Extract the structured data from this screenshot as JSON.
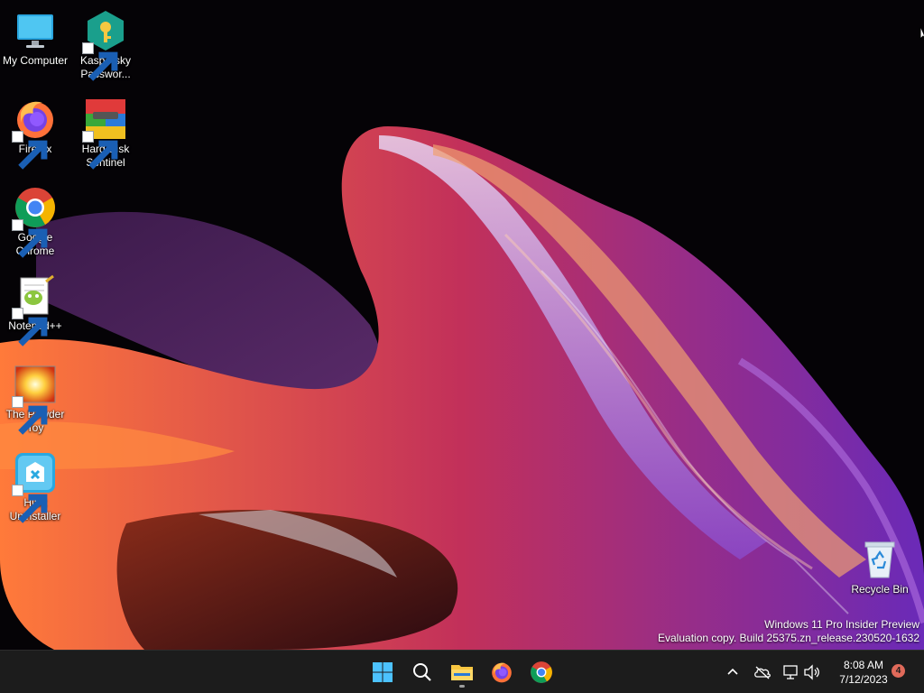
{
  "desktop": {
    "icons": [
      {
        "label": "My Computer",
        "icon": "monitor-icon"
      },
      {
        "label": "Kaspersky Passwor...",
        "icon": "kaspersky-password-icon"
      },
      {
        "label": "Firefox",
        "icon": "firefox-icon"
      },
      {
        "label": "Hard Disk Sentinel",
        "icon": "hard-disk-sentinel-icon"
      },
      {
        "label": "Google Chrome",
        "icon": "chrome-icon"
      },
      {
        "label": "Notepad++",
        "icon": "notepad-plus-plus-icon"
      },
      {
        "label": "The Powder Toy",
        "icon": "powder-toy-icon"
      },
      {
        "label": "HiBit Uninstaller",
        "icon": "hibit-uninstaller-icon"
      },
      {
        "label": "Recycle Bin",
        "icon": "recycle-bin-icon"
      }
    ],
    "watermark": {
      "line1": "Windows 11 Pro Insider Preview",
      "line2": "Evaluation copy. Build 25375.zn_release.230520-1632"
    }
  },
  "taskbar": {
    "pinned": [
      {
        "icon": "windows-start-icon"
      },
      {
        "icon": "search-icon"
      },
      {
        "icon": "file-explorer-icon",
        "running": true
      },
      {
        "icon": "firefox-icon"
      },
      {
        "icon": "chrome-icon"
      }
    ],
    "tray": {
      "icons": [
        "chevron-up-icon",
        "onedrive-offline-icon",
        "network-icon",
        "volume-icon"
      ],
      "time": "8:08 AM",
      "date": "7/12/2023",
      "notification_count": "4"
    }
  },
  "colors": {
    "taskbar_bg": "#1c1c1c",
    "windows_blue": "#4cc2ff",
    "badge": "#e06a5a"
  }
}
